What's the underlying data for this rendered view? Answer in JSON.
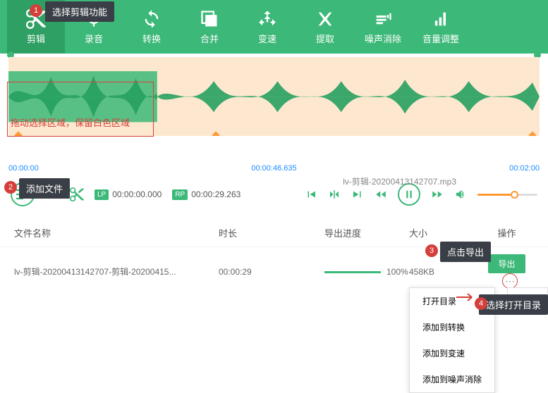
{
  "tooltips": {
    "tab": "选择剪辑功能",
    "addfile": "添加文件",
    "export": "点击导出",
    "opendir": "选择打开目录"
  },
  "badges": {
    "b1": "1",
    "b2": "2",
    "b3": "3",
    "b4": "4"
  },
  "tabs": {
    "cut": "剪辑",
    "rec": "录音",
    "conv": "转换",
    "merge": "合并",
    "speed": "变速",
    "extract": "提取",
    "noise": "噪声消除",
    "vol": "音量调整"
  },
  "wave": {
    "redtext": "拖动选择区域，保留白色区域",
    "t_start": "00:00:00",
    "t_mid": "00:00:46.635",
    "t_end": "00:02:00"
  },
  "controls": {
    "filename": "lv-剪辑-20200413142707.mp3",
    "lp": "LP",
    "rp": "RP",
    "time_lp": "00:00:00.000",
    "time_rp": "00:00:29.263"
  },
  "table": {
    "h_name": "文件名称",
    "h_dur": "时长",
    "h_prog": "导出进度",
    "h_size": "大小",
    "h_op": "操作",
    "rows": [
      {
        "name": "lv-剪辑-20200413142707-剪辑-20200415...",
        "dur": "00:00:29",
        "prog": "100%",
        "size": "458KB",
        "export": "导出"
      }
    ]
  },
  "dropdown": [
    "打开目录",
    "添加到转换",
    "添加到变速",
    "添加到噪声消除"
  ],
  "moreop": "更多操作"
}
